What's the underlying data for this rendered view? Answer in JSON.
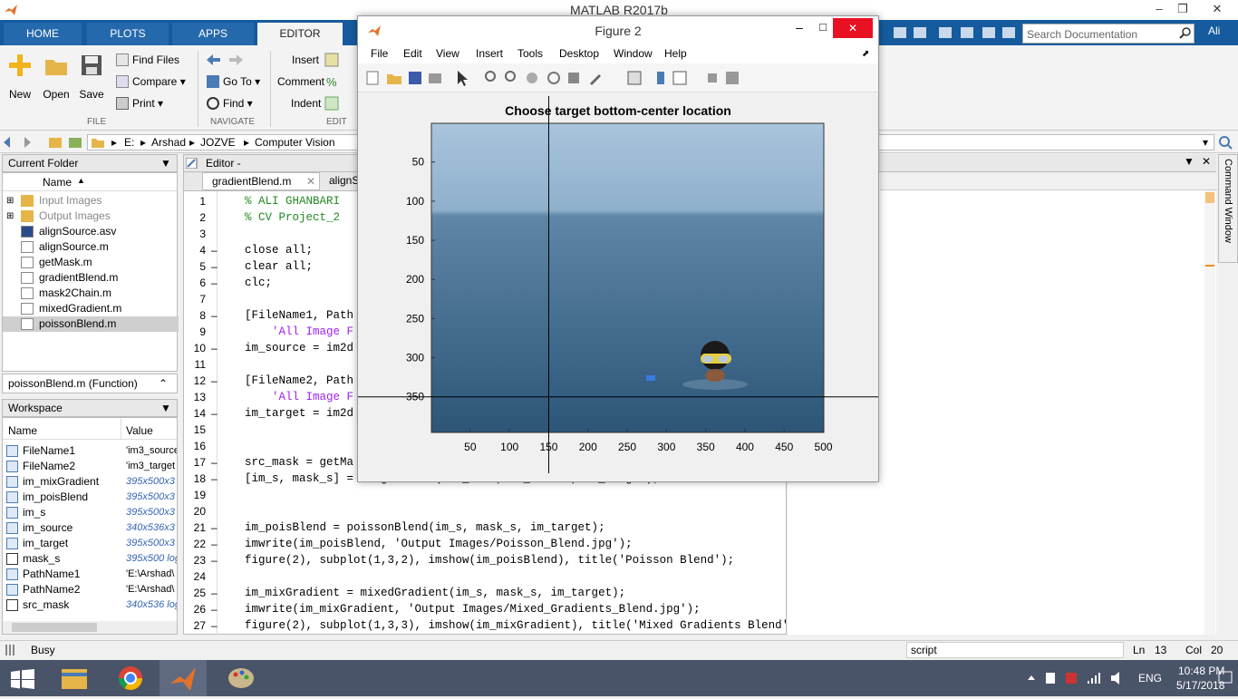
{
  "window": {
    "title": "MATLAB R2017b",
    "user": "Ali"
  },
  "tabs": [
    "HOME",
    "PLOTS",
    "APPS",
    "EDITOR"
  ],
  "search": {
    "placeholder": "Search Documentation"
  },
  "ribbon": {
    "file": {
      "new": "New",
      "open": "Open",
      "save": "Save",
      "find_files": "Find Files",
      "compare": "Compare",
      "print": "Print",
      "group": "FILE"
    },
    "navigate": {
      "go_to": "Go To",
      "find": "Find",
      "group": "NAVIGATE"
    },
    "edit": {
      "insert": "Insert",
      "comment": "Comment",
      "indent": "Indent",
      "group": "EDIT"
    }
  },
  "address": {
    "path": [
      "E:",
      "Arshad",
      "JOZVE",
      "Computer Vision"
    ]
  },
  "current_folder": {
    "title": "Current Folder",
    "col_name": "Name",
    "items": [
      "Input Images",
      "Output Images",
      "alignSource.asv",
      "alignSource.m",
      "getMask.m",
      "gradientBlend.m",
      "mask2Chain.m",
      "mixedGradient.m",
      "poissonBlend.m"
    ],
    "details": "poissonBlend.m  (Function)"
  },
  "workspace": {
    "title": "Workspace",
    "col_name": "Name",
    "col_value": "Value",
    "vars": [
      {
        "name": "FileName1",
        "value": "'im3_source"
      },
      {
        "name": "FileName2",
        "value": "'im3_target"
      },
      {
        "name": "im_mixGradient",
        "value": "395x500x3 d"
      },
      {
        "name": "im_poisBlend",
        "value": "395x500x3 d"
      },
      {
        "name": "im_s",
        "value": "395x500x3 d"
      },
      {
        "name": "im_source",
        "value": "340x536x3 d"
      },
      {
        "name": "im_target",
        "value": "395x500x3 d"
      },
      {
        "name": "mask_s",
        "value": "395x500 log"
      },
      {
        "name": "PathName1",
        "value": "'E:\\Arshad\\"
      },
      {
        "name": "PathName2",
        "value": "'E:\\Arshad\\"
      },
      {
        "name": "src_mask",
        "value": "340x536 log"
      }
    ]
  },
  "editor": {
    "title": "Editor - E:\\Arshad\\JOZVE\\Comp",
    "tabs": [
      "gradientBlend.m",
      "alignS"
    ],
    "lines": [
      {
        "n": "1",
        "t": "% ALI GHANBARI",
        "c": "cm"
      },
      {
        "n": "2",
        "t": "% CV Project_2",
        "c": "cm"
      },
      {
        "n": "3",
        "t": ""
      },
      {
        "n": "4",
        "t": "close all;",
        "d": "–"
      },
      {
        "n": "5",
        "t": "clear all;",
        "d": "–"
      },
      {
        "n": "6",
        "t": "clc;",
        "d": "–"
      },
      {
        "n": "7",
        "t": ""
      },
      {
        "n": "8",
        "t": "[FileName1, Path",
        "d": "–"
      },
      {
        "n": "9",
        "t": "    'All Image F",
        "c": "str"
      },
      {
        "n": "10",
        "t": "im_source = im2d",
        "d": "–"
      },
      {
        "n": "11",
        "t": ""
      },
      {
        "n": "12",
        "t": "[FileName2, Path",
        "d": "–"
      },
      {
        "n": "13",
        "t": "    'All Image F",
        "c": "str"
      },
      {
        "n": "14",
        "t": "im_target = im2d",
        "d": "–"
      },
      {
        "n": "15",
        "t": ""
      },
      {
        "n": "16",
        "t": ""
      },
      {
        "n": "17",
        "t": "src_mask = getMa",
        "d": "–"
      },
      {
        "n": "18",
        "t": "[im_s, mask_s] = alignSource(src_mask, im_source, im_target);",
        "d": "–"
      },
      {
        "n": "19",
        "t": ""
      },
      {
        "n": "20",
        "t": ""
      },
      {
        "n": "21",
        "t": "im_poisBlend = poissonBlend(im_s, mask_s, im_target);",
        "d": "–"
      },
      {
        "n": "22",
        "t": "imwrite(im_poisBlend, 'Output Images/Poisson_Blend.jpg');",
        "d": "–"
      },
      {
        "n": "23",
        "t": "figure(2), subplot(1,3,2), imshow(im_poisBlend), title('Poisson Blend');",
        "d": "–"
      },
      {
        "n": "24",
        "t": ""
      },
      {
        "n": "25",
        "t": "im_mixGradient = mixedGradient(im_s, mask_s, im_target);",
        "d": "–"
      },
      {
        "n": "26",
        "t": "imwrite(im_mixGradient, 'Output Images/Mixed_Gradients_Blend.jpg');",
        "d": "–"
      },
      {
        "n": "27",
        "t": "figure(2), subplot(1,3,3), imshow(im_mixGradient), title('Mixed Gradients Blend');",
        "d": "–"
      }
    ]
  },
  "figure": {
    "title": "Figure 2",
    "menu": [
      "File",
      "Edit",
      "View",
      "Insert",
      "Tools",
      "Desktop",
      "Window",
      "Help"
    ],
    "plot_title": "Choose target bottom-center location",
    "xticks": [
      "50",
      "100",
      "150",
      "200",
      "250",
      "300",
      "350",
      "400",
      "450",
      "500"
    ],
    "yticks": [
      "50",
      "100",
      "150",
      "200",
      "250",
      "300",
      "350"
    ],
    "crosshair": {
      "x": 150,
      "y": 350
    }
  },
  "command_window": {
    "label": "Command Window"
  },
  "status": {
    "state": "Busy",
    "mode": "script",
    "ln_label": "Ln",
    "ln": "13",
    "col_label": "Col",
    "col": "20"
  },
  "taskbar": {
    "lang": "ENG",
    "time": "10:48 PM",
    "date": "5/17/2018"
  },
  "colors": {
    "tab_bar": "#155b9d",
    "accent": "#e81123",
    "sea": "#3c6a8f",
    "sky": "#a9c4dc"
  }
}
